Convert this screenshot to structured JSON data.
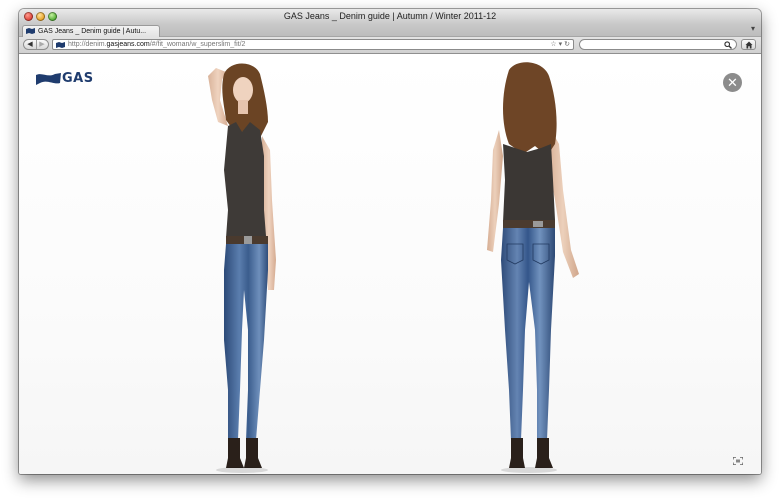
{
  "window": {
    "title": "GAS Jeans _ Denim guide | Autumn / Winter 2011-12"
  },
  "tabs": [
    {
      "label": "GAS Jeans _ Denim guide | Autu..."
    }
  ],
  "toolbar": {
    "url_prefix": "http://denim.",
    "url_host": "gasjeans.com",
    "url_path": "/#/fit_woman/w_superslim_fit/2",
    "search_placeholder": ""
  },
  "page": {
    "logo_text": "GAS",
    "close_glyph": "✕",
    "images": [
      {
        "name": "model-front-view"
      },
      {
        "name": "model-back-view"
      }
    ]
  },
  "icons": {
    "back": "back-arrow-icon",
    "forward": "forward-arrow-icon",
    "bookmark": "star-icon",
    "reload": "reload-icon",
    "search": "search-icon",
    "home": "home-icon",
    "close": "close-icon",
    "fullscreen": "fullscreen-icon"
  },
  "colors": {
    "brand": "#1f3c6e",
    "close_button": "#8c8c8c"
  }
}
